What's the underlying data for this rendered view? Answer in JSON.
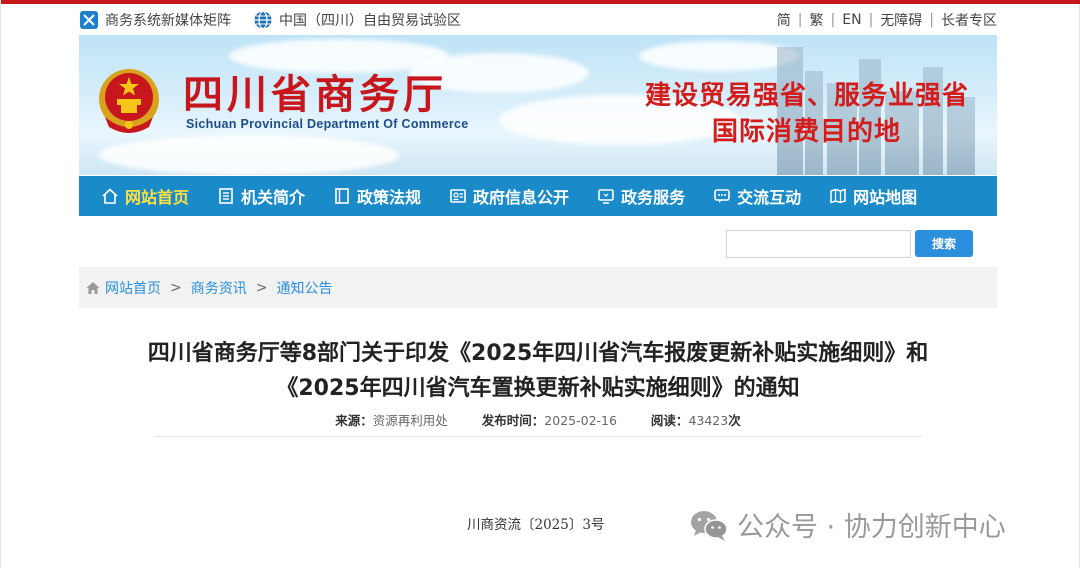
{
  "topbar": {
    "left_links": [
      {
        "label": "商务系统新媒体矩阵",
        "icon": "matrix-icon"
      },
      {
        "label": "中国（四川）自由贸易试验区",
        "icon": "globe-icon"
      }
    ],
    "right_links": [
      "简",
      "繁",
      "EN",
      "无障碍",
      "长者专区"
    ]
  },
  "header": {
    "title": "四川省商务厅",
    "subtitle": "Sichuan Provincial Department Of Commerce",
    "slogan_line1": "建设贸易强省、服务业强省",
    "slogan_line2": "国际消费目的地",
    "accent": "#c8161d"
  },
  "nav": {
    "background": "#1a8bc8",
    "active_color": "#ffe042",
    "items": [
      {
        "label": "网站首页",
        "icon": "home-icon",
        "active": true
      },
      {
        "label": "机关简介",
        "icon": "document-icon",
        "active": false
      },
      {
        "label": "政策法规",
        "icon": "book-icon",
        "active": false
      },
      {
        "label": "政府信息公开",
        "icon": "id-card-icon",
        "active": false
      },
      {
        "label": "政务服务",
        "icon": "monitor-icon",
        "active": false
      },
      {
        "label": "交流互动",
        "icon": "chat-icon",
        "active": false
      },
      {
        "label": "网站地图",
        "icon": "map-icon",
        "active": false
      }
    ]
  },
  "search": {
    "value": "",
    "placeholder": "",
    "button_label": "搜索"
  },
  "breadcrumb": {
    "items": [
      "网站首页",
      "商务资讯",
      "通知公告"
    ],
    "separator": ">"
  },
  "article": {
    "title_line1": "四川省商务厅等8部门关于印发《2025年四川省汽车报废更新补贴实施细则》和",
    "title_line2": "《2025年四川省汽车置换更新补贴实施细则》的通知",
    "source_label": "来源：",
    "source_value": "资源再利用处",
    "date_label": "发布时间：",
    "date_value": "2025-02-16",
    "views_label": "阅读：",
    "views_value": "43423",
    "views_unit": "次",
    "doc_number": "川商资流〔2025〕3号"
  },
  "watermark": {
    "text": "公众号 · 协力创新中心",
    "icon": "wechat-icon"
  }
}
